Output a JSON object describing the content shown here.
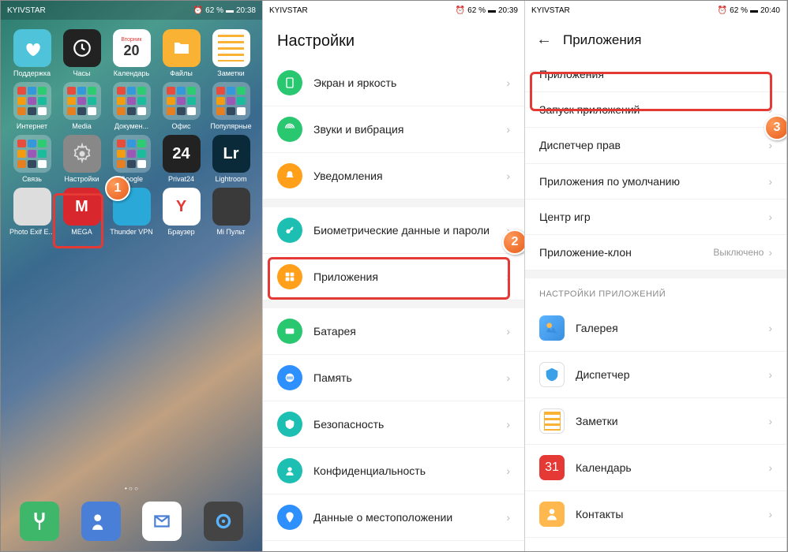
{
  "s1": {
    "carrier": "KYIVSTAR",
    "battery": "62 %",
    "time": "20:38",
    "apps_row1": [
      {
        "label": "Поддержка",
        "bg": "#4fc3d9"
      },
      {
        "label": "Часы",
        "bg": "#222"
      },
      {
        "label": "Календарь",
        "bg": "#fff",
        "badge": "20"
      },
      {
        "label": "Файлы",
        "bg": "#f9b233"
      },
      {
        "label": "Заметки",
        "bg": "#fff"
      }
    ],
    "apps_row2": [
      {
        "label": "Интернет",
        "folder": true
      },
      {
        "label": "Media",
        "folder": true
      },
      {
        "label": "Докумен...",
        "folder": true
      },
      {
        "label": "Офис",
        "folder": true
      },
      {
        "label": "Популярные",
        "folder": true
      }
    ],
    "apps_row3": [
      {
        "label": "Связь",
        "folder": true
      },
      {
        "label": "Настройки",
        "bg": "#888"
      },
      {
        "label": "Google",
        "folder": true
      },
      {
        "label": "Privat24",
        "bg": "#222",
        "txt": "24"
      },
      {
        "label": "Lightroom",
        "bg": "#0a2a3a",
        "txt": "Lr"
      }
    ],
    "apps_row4": [
      {
        "label": "Photo Exif E...",
        "bg": "#ddd"
      },
      {
        "label": "MEGA",
        "bg": "#d9272e",
        "txt": "M"
      },
      {
        "label": "Thunder VPN",
        "bg": "#2aa8d8"
      },
      {
        "label": "Браузер",
        "bg": "#fff",
        "txt": "Y"
      },
      {
        "label": "Mi Пульт",
        "bg": "#3a3a3a"
      }
    ],
    "dock": [
      {
        "bg": "#3fb76a"
      },
      {
        "bg": "#4a7fd8"
      },
      {
        "bg": "#fff"
      },
      {
        "bg": "#444"
      }
    ],
    "calendar_day": "Вторник",
    "calendar_num": "20"
  },
  "s2": {
    "carrier": "KYIVSTAR",
    "battery": "62 %",
    "time": "20:39",
    "title": "Настройки",
    "rows": [
      {
        "label": "Экран и яркость",
        "color": "#29c76f"
      },
      {
        "label": "Звуки и вибрация",
        "color": "#29c76f"
      },
      {
        "label": "Уведомления",
        "color": "#ff9f1a"
      },
      {
        "label": "Биометрические данные и пароли",
        "color": "#1ebfb3"
      },
      {
        "label": "Приложения",
        "color": "#ff9f1a"
      },
      {
        "label": "Батарея",
        "color": "#29c76f"
      },
      {
        "label": "Память",
        "color": "#2e8fff"
      },
      {
        "label": "Безопасность",
        "color": "#1ebfb3"
      },
      {
        "label": "Конфиденциальность",
        "color": "#1ebfb3"
      },
      {
        "label": "Данные о местоположении",
        "color": "#2e8fff"
      }
    ]
  },
  "s3": {
    "carrier": "KYIVSTAR",
    "battery": "62 %",
    "time": "20:40",
    "title": "Приложения",
    "rows": [
      {
        "label": "Приложения"
      },
      {
        "label": "Запуск приложений"
      },
      {
        "label": "Диспетчер прав"
      },
      {
        "label": "Приложения по умолчанию"
      },
      {
        "label": "Центр игр"
      },
      {
        "label": "Приложение-клон",
        "val": "Выключено"
      }
    ],
    "section": "НАСТРОЙКИ ПРИЛОЖЕНИЙ",
    "app_rows": [
      {
        "label": "Галерея",
        "bg": "linear-gradient(135deg,#5ab4ff,#3a8fe0)"
      },
      {
        "label": "Диспетчер",
        "bg": "#fff",
        "border": "1px solid #ddd"
      },
      {
        "label": "Заметки",
        "bg": "#fff",
        "border": "1px solid #ddd"
      },
      {
        "label": "Календарь",
        "bg": "#e53935",
        "txt": "31"
      },
      {
        "label": "Контакты",
        "bg": "#ffb84d"
      }
    ]
  },
  "badges": {
    "b1": "1",
    "b2": "2",
    "b3": "3"
  }
}
